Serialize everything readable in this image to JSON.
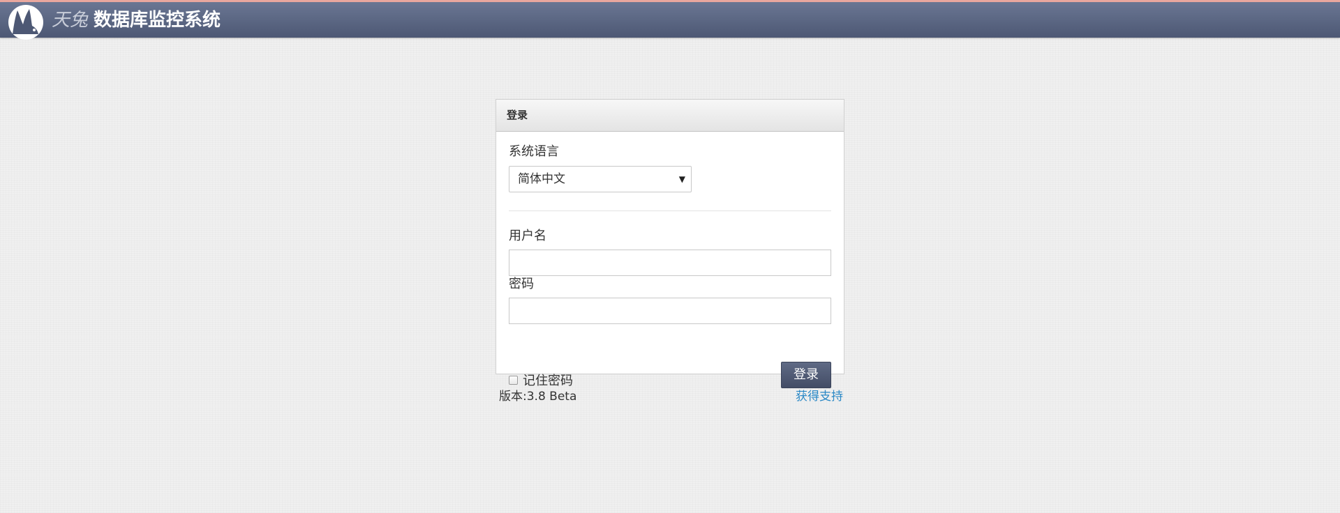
{
  "app": {
    "brand_italic": "天兔",
    "brand_title": "数据库监控系统",
    "logo_icon": "rabbit-logo-icon"
  },
  "login_panel": {
    "title": "登录",
    "language_label": "系统语言",
    "language_selected": "简体中文",
    "username_label": "用户名",
    "username_value": "",
    "password_label": "密码",
    "password_value": "",
    "remember_label": "记住密码",
    "remember_checked": false,
    "submit_label": "登录"
  },
  "footer": {
    "version": "版本:3.8 Beta",
    "support_link": "获得支持"
  },
  "colors": {
    "header_top": "#6a7693",
    "header_bottom": "#4d5874",
    "header_accent": "#e9a79e",
    "button": "#4f5a74",
    "link": "#2a88c6"
  }
}
